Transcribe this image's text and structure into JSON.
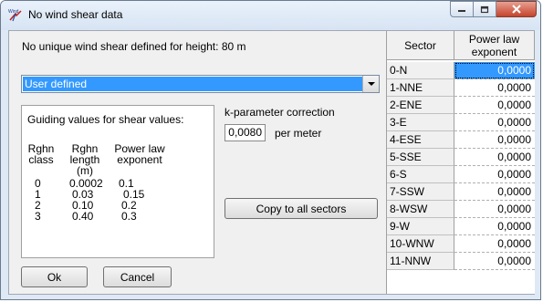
{
  "window": {
    "title": "No wind shear data",
    "icon": "wind-app-icon",
    "icon_text": "Wind",
    "buttons": [
      "minimize",
      "maximize",
      "close"
    ],
    "close_color": "#c4432c"
  },
  "dialog": {
    "message": "No unique wind shear defined for height: 80 m",
    "combo_value": "User defined",
    "guide": {
      "title": "Guiding values for shear values:",
      "headers": {
        "class": [
          "Rghn",
          "class"
        ],
        "length": [
          "Rghn",
          "length",
          "(m)"
        ],
        "exponent": [
          "Power law",
          "exponent"
        ]
      },
      "rows": [
        {
          "class": "0",
          "length": "0.0002",
          "exponent": "0.1"
        },
        {
          "class": "1",
          "length": "0.03",
          "exponent": "0.15"
        },
        {
          "class": "2",
          "length": "0.10",
          "exponent": "0.2"
        },
        {
          "class": "3",
          "length": "0.40",
          "exponent": "0.3"
        }
      ]
    },
    "k_label": "k-parameter correction",
    "k_value": "0,0080",
    "k_unit": "per meter",
    "copy_button": "Copy to all sectors",
    "ok_button": "Ok",
    "cancel_button": "Cancel",
    "selection_color": "#3399ff"
  },
  "table": {
    "headers": {
      "sector": "Sector",
      "exponent": "Power law exponent"
    },
    "rows": [
      {
        "sector": "0-N",
        "value": "0,0000"
      },
      {
        "sector": "1-NNE",
        "value": "0,0000"
      },
      {
        "sector": "2-ENE",
        "value": "0,0000"
      },
      {
        "sector": "3-E",
        "value": "0,0000"
      },
      {
        "sector": "4-ESE",
        "value": "0,0000"
      },
      {
        "sector": "5-SSE",
        "value": "0,0000"
      },
      {
        "sector": "6-S",
        "value": "0,0000"
      },
      {
        "sector": "7-SSW",
        "value": "0,0000"
      },
      {
        "sector": "8-WSW",
        "value": "0,0000"
      },
      {
        "sector": "9-W",
        "value": "0,0000"
      },
      {
        "sector": "10-WNW",
        "value": "0,0000"
      },
      {
        "sector": "11-NNW",
        "value": "0,0000"
      }
    ],
    "selected_row": 0
  }
}
